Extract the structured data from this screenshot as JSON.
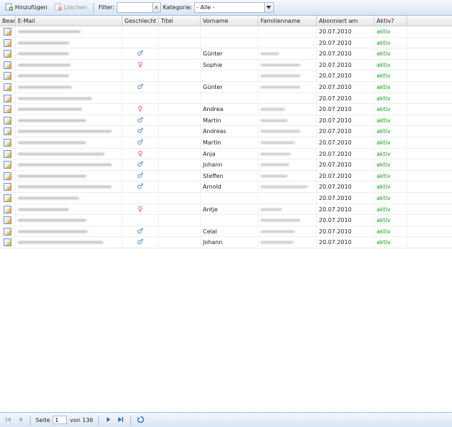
{
  "toolbar": {
    "add_label": "Hinzufügen",
    "delete_label": "Löschen",
    "filter_label": "Filter:",
    "filter_value": "",
    "clear_glyph": "×",
    "category_label": "Kategorie:",
    "category_value": "- Alle -"
  },
  "columns": [
    "Bear",
    "E-Mail",
    "Geschlecht",
    "Titel",
    "Vorname",
    "Familienname",
    "Abonniert am",
    "Aktiv?"
  ],
  "rows": [
    {
      "gender": "",
      "first": "",
      "date": "20.07.2010",
      "active": "aktiv"
    },
    {
      "gender": "",
      "first": "",
      "date": "20.07.2010",
      "active": "aktiv"
    },
    {
      "gender": "m",
      "first": "Günter",
      "date": "20.07.2010",
      "active": "aktiv"
    },
    {
      "gender": "f",
      "first": "Sophie",
      "date": "20.07.2010",
      "active": "aktiv"
    },
    {
      "gender": "",
      "first": "",
      "date": "20.07.2010",
      "active": "aktiv"
    },
    {
      "gender": "m",
      "first": "Günter",
      "date": "20.07.2010",
      "active": "aktiv"
    },
    {
      "gender": "",
      "first": "",
      "date": "20.07.2010",
      "active": "aktiv"
    },
    {
      "gender": "f",
      "first": "Andrea",
      "date": "20.07.2010",
      "active": "aktiv"
    },
    {
      "gender": "m",
      "first": "Martin",
      "date": "20.07.2010",
      "active": "aktiv"
    },
    {
      "gender": "m",
      "first": "Andreas",
      "date": "20.07.2010",
      "active": "aktiv"
    },
    {
      "gender": "m",
      "first": "Martin",
      "date": "20.07.2010",
      "active": "aktiv"
    },
    {
      "gender": "f",
      "first": "Anja",
      "date": "20.07.2010",
      "active": "aktiv"
    },
    {
      "gender": "m",
      "first": "Johann",
      "date": "20.07.2010",
      "active": "aktiv"
    },
    {
      "gender": "m",
      "first": "Steffen",
      "date": "20.07.2010",
      "active": "aktiv"
    },
    {
      "gender": "m",
      "first": "Arnold",
      "date": "20.07.2010",
      "active": "aktiv"
    },
    {
      "gender": "",
      "first": "",
      "date": "20.07.2010",
      "active": "aktiv"
    },
    {
      "gender": "f",
      "first": "Antje",
      "date": "20.07.2010",
      "active": "aktiv"
    },
    {
      "gender": "",
      "first": "",
      "date": "20.07.2010",
      "active": "aktiv"
    },
    {
      "gender": "m",
      "first": "Celal",
      "date": "20.07.2010",
      "active": "aktiv"
    },
    {
      "gender": "m",
      "first": "Johann",
      "date": "20.07.2010",
      "active": "aktiv"
    }
  ],
  "gender_glyphs": {
    "m": "♂",
    "f": "♀"
  },
  "pager": {
    "page_label": "Seite",
    "page_value": "1",
    "of_label": "von 136"
  },
  "icons": {
    "add": "add-contact-icon",
    "delete": "delete-contact-icon",
    "edit": "edit-icon",
    "male": "male-icon",
    "female": "female-icon",
    "first": "first-page-icon",
    "prev": "previous-page-icon",
    "next": "next-page-icon",
    "last": "last-page-icon",
    "refresh": "refresh-icon"
  },
  "colors": {
    "active": "#1a9c1a",
    "male": "#4f86c9",
    "female": "#d94fb5",
    "toolbar_border": "#99bbe8"
  }
}
